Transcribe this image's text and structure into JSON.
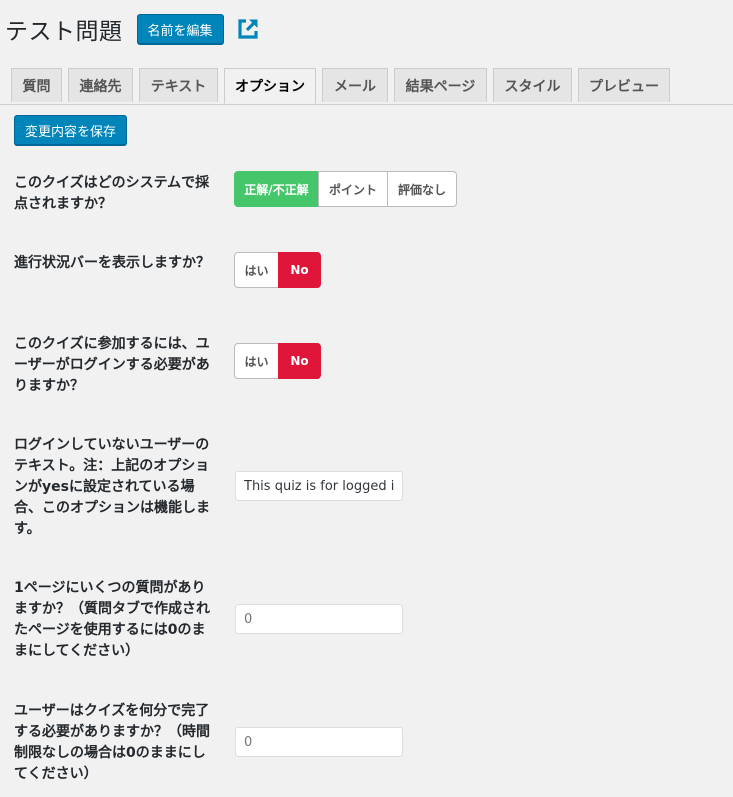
{
  "header": {
    "title": "テスト問題",
    "rename_label": "名前を編集",
    "external_icon": "external-link-icon"
  },
  "tabs": [
    {
      "label": "質問"
    },
    {
      "label": "連絡先"
    },
    {
      "label": "テキスト"
    },
    {
      "label": "オプション",
      "active": true
    },
    {
      "label": "メール"
    },
    {
      "label": "結果ページ"
    },
    {
      "label": "スタイル"
    },
    {
      "label": "プレビュー"
    }
  ],
  "save_label": "変更内容を保存",
  "options": {
    "scoring": {
      "label": "このクイズはどのシステムで採点されますか？",
      "choices": [
        "正解/不正解",
        "ポイント",
        "評価なし"
      ],
      "selected": "正解/不正解"
    },
    "progress_bar": {
      "label": "進行状況バーを表示しますか？",
      "choices": [
        "はい",
        "No"
      ],
      "selected": "No"
    },
    "require_login": {
      "label": "このクイズに参加するには、ユーザーがログインする必要がありますか？",
      "choices": [
        "はい",
        "No"
      ],
      "selected": "No"
    },
    "logged_out_text": {
      "label": "ログインしていないユーザーのテキスト。注：上記のオプションがyesに設定されている場合、このオプションは機能します。",
      "value": "This quiz is for logged in users only."
    },
    "questions_per_page": {
      "label": "1ページにいくつの質問がありますか？（質問タブで作成されたページを使用するには0のままにしてください）",
      "placeholder": "0"
    },
    "time_limit": {
      "label": "ユーザーはクイズを何分で完了する必要がありますか？（時間制限なしの場合は0のままにしてください）",
      "placeholder": "0"
    }
  },
  "colors": {
    "primary": "#0085ba",
    "selected_green": "#46c66b",
    "selected_red": "#e0153a",
    "background": "#f1f1f1"
  }
}
